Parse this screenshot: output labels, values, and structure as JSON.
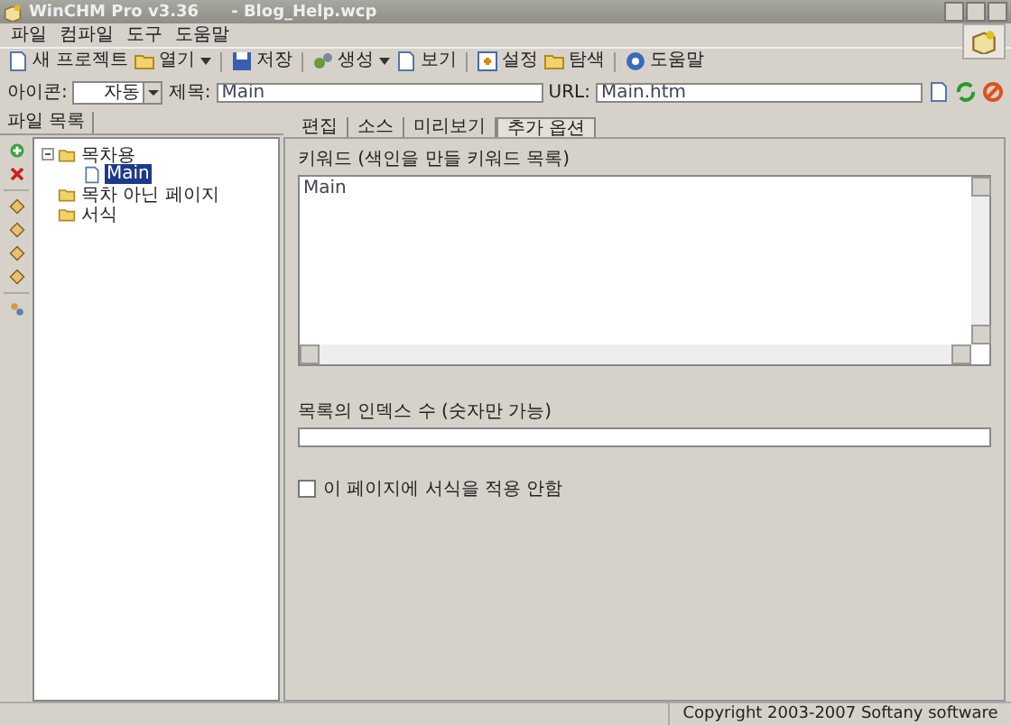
{
  "window": {
    "title": "WinCHM Pro v3.36",
    "document": "- Blog_Help.wcp"
  },
  "menu": [
    "파일",
    "컴파일",
    "도구",
    "도움말"
  ],
  "toolbar": [
    {
      "label": "새 프로젝트",
      "caret": false
    },
    {
      "label": "열기",
      "caret": true
    },
    {
      "label": "저장",
      "caret": false
    },
    {
      "label": "생성",
      "caret": true
    },
    {
      "label": "보기",
      "caret": false
    },
    {
      "label": "설정",
      "caret": false
    },
    {
      "label": "탐색",
      "caret": false
    },
    {
      "label": "도움말",
      "caret": false
    }
  ],
  "topic_bar": {
    "icon_label": "아이콘:",
    "icon_value": "자동",
    "title_label": "제목:",
    "title_value": "Main",
    "url_label": "URL:",
    "url_value": "Main.htm"
  },
  "left_panel": {
    "tab": "파일 목록",
    "tree": [
      {
        "label": "목차용",
        "kind": "folder",
        "expanded": true,
        "selected": false,
        "children": [
          {
            "label": "Main",
            "kind": "page",
            "selected": true
          }
        ]
      },
      {
        "label": "목차 아닌 페이지",
        "kind": "folder",
        "selected": false
      },
      {
        "label": "서식",
        "kind": "folder",
        "selected": false
      }
    ]
  },
  "tabs": [
    {
      "label": "편집",
      "selected": false
    },
    {
      "label": "소스",
      "selected": false
    },
    {
      "label": "미리보기",
      "selected": false
    },
    {
      "label": "추가 옵션",
      "selected": true
    }
  ],
  "options": {
    "keywords_label": "키워드 (색인을 만들 키워드 목록)",
    "keywords_value": "Main",
    "order_label": "목록의 인덱스 수 (숫자만 가능)",
    "no_template_label": "이 페이지에 서식을 적용 안함",
    "no_template_checked": false
  },
  "status_bar": {
    "text": "Copyright 2003-2007 Softany software"
  }
}
